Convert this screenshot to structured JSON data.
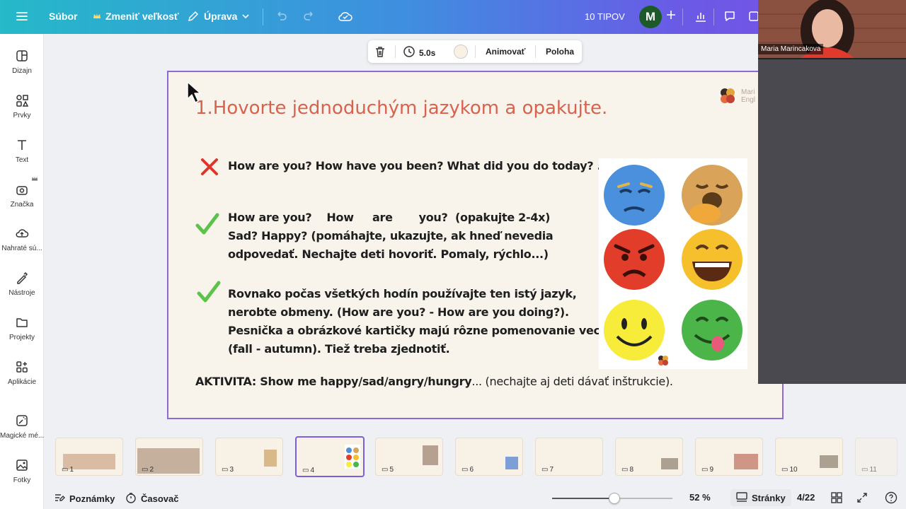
{
  "topbar": {
    "menu_icon": "hamburger-icon",
    "file": "Súbor",
    "resize": "Zmeniť veľkosť",
    "edit": "Úprava",
    "tips": "10 TIPOV",
    "avatar_initial": "M"
  },
  "sidebar": {
    "items": [
      {
        "label": "Dizajn",
        "icon": "layout-icon"
      },
      {
        "label": "Prvky",
        "icon": "elements-icon"
      },
      {
        "label": "Text",
        "icon": "text-icon"
      },
      {
        "label": "Značka",
        "icon": "brand-icon"
      },
      {
        "label": "Nahraté sú...",
        "icon": "upload-icon"
      },
      {
        "label": "Nástroje",
        "icon": "tools-icon"
      },
      {
        "label": "Projekty",
        "icon": "folder-icon"
      },
      {
        "label": "Aplikácie",
        "icon": "apps-icon"
      },
      {
        "label": "Magické mé...",
        "icon": "magic-media-icon"
      },
      {
        "label": "Fotky",
        "icon": "photos-icon"
      }
    ]
  },
  "floating_toolbar": {
    "duration": "5.0s",
    "animate": "Animovať",
    "position": "Poloha"
  },
  "slide": {
    "title": "1.Hovorte jednoduchým jazykom a opakujte.",
    "logo_text": "Mari\nEngl",
    "point1": "How are you? How have you been? What did you do today? .",
    "point2": [
      "How are you?    How     are       you?  (opakujte 2-4x)",
      "Sad? Happy?  (pomáhajte, ukazujte, ak hneď nevedia",
      "odpovedať. Nechajte deti hovoriť. Pomaly, rýchlo...)"
    ],
    "point3": [
      "Rovnako počas všetkých hodín používajte ten istý jazyk,",
      "nerobte obmeny. (How are you? - How are you doing?).",
      "Pesnička a obrázkové kartičky majú rôzne pomenovanie vecí",
      "(fall - autumn). Tiež treba zjednotiť."
    ],
    "activity_bold": "AKTIVITA: Show me happy/sad/angry/hungry",
    "activity_rest": "... (nechajte aj deti dávať inštrukcie).",
    "card_logo": "Maria\nEnglish",
    "colors": {
      "title": "#d9624e",
      "check": "#5cc34a",
      "cross": "#e0352b"
    }
  },
  "video": {
    "name": "Maria Marincakova"
  },
  "thumbnails": [
    "1",
    "2",
    "3",
    "4",
    "5",
    "6",
    "7",
    "8",
    "9",
    "10",
    "11"
  ],
  "bottombar": {
    "notes": "Poznámky",
    "timer": "Časovač",
    "zoom": "52 %",
    "zoom_fraction": 0.52,
    "pages": "Stránky",
    "page_count": "4/22"
  }
}
